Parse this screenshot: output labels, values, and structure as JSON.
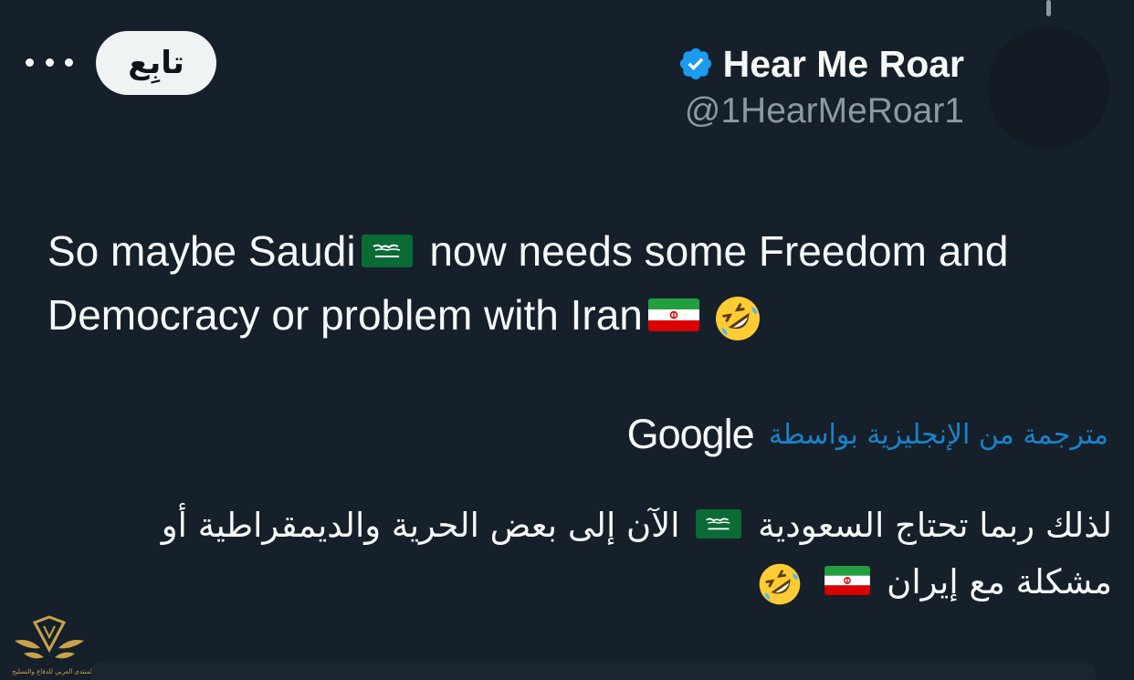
{
  "colors": {
    "background": "#15202b",
    "text_primary": "#f7f9f9",
    "text_secondary": "#8b98a5",
    "accent": "#1d9bf0",
    "follow_button_bg": "#eff3f4"
  },
  "header": {
    "display_name": "Hear Me Roar",
    "handle": "@1HearMeRoar1",
    "verified_icon": "verified-badge-icon",
    "follow_label": "تابِع",
    "more_icon": "more-options-icon"
  },
  "tweet": {
    "line1_before": "So maybe Saudi",
    "line1_after": "now needs some Freedom and",
    "line2": "Democracy or problem with Iran",
    "emojis": [
      "saudi-flag-icon",
      "iran-flag-icon",
      "rofl-emoji-icon"
    ]
  },
  "translation": {
    "translated_by": "مترجمة من الإنجليزية بواسطة",
    "provider": "Google",
    "text_part1": "لذلك ربما تحتاج السعودية",
    "text_part2": "الآن إلى بعض الحرية والديمقراطية أو",
    "text_part3": "مشكلة مع إيران"
  },
  "watermark": {
    "icon": "forum-logo-icon",
    "text": "المنتدى العربي للدفاع والتسليح"
  }
}
